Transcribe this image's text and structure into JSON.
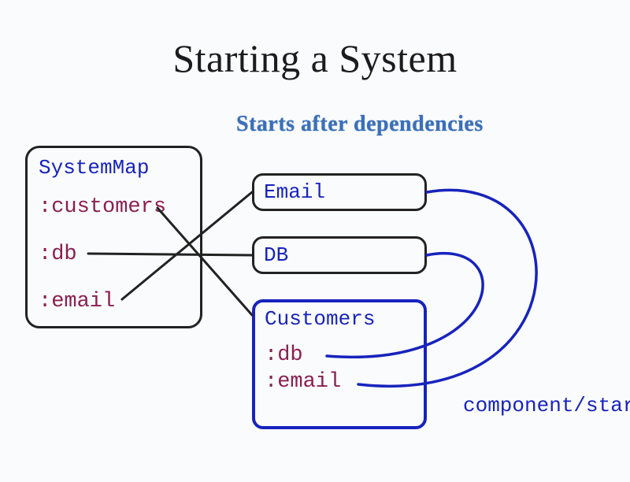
{
  "title": "Starting a System",
  "subtitle": "Starts after dependencies",
  "system_map": {
    "heading": "SystemMap",
    "keys": [
      ":customers",
      ":db",
      ":email"
    ]
  },
  "components": {
    "email": {
      "label": "Email"
    },
    "db": {
      "label": "DB"
    },
    "customers": {
      "label": "Customers",
      "deps": [
        ":db",
        ":email"
      ]
    }
  },
  "edges_black": [
    {
      "from": ":customers",
      "to": "Customers"
    },
    {
      "from": ":db",
      "to": "DB"
    },
    {
      "from": ":email",
      "to": "Email"
    }
  ],
  "edges_blue": [
    {
      "from": "Customers:db",
      "to": "DB"
    },
    {
      "from": "Customers:email",
      "to": "Email"
    }
  ],
  "footer": "component/start",
  "colors": {
    "blue": "#1723bd",
    "maroon": "#8a1f52",
    "subtitle_blue": "#3b6fb8",
    "black": "#222222"
  }
}
